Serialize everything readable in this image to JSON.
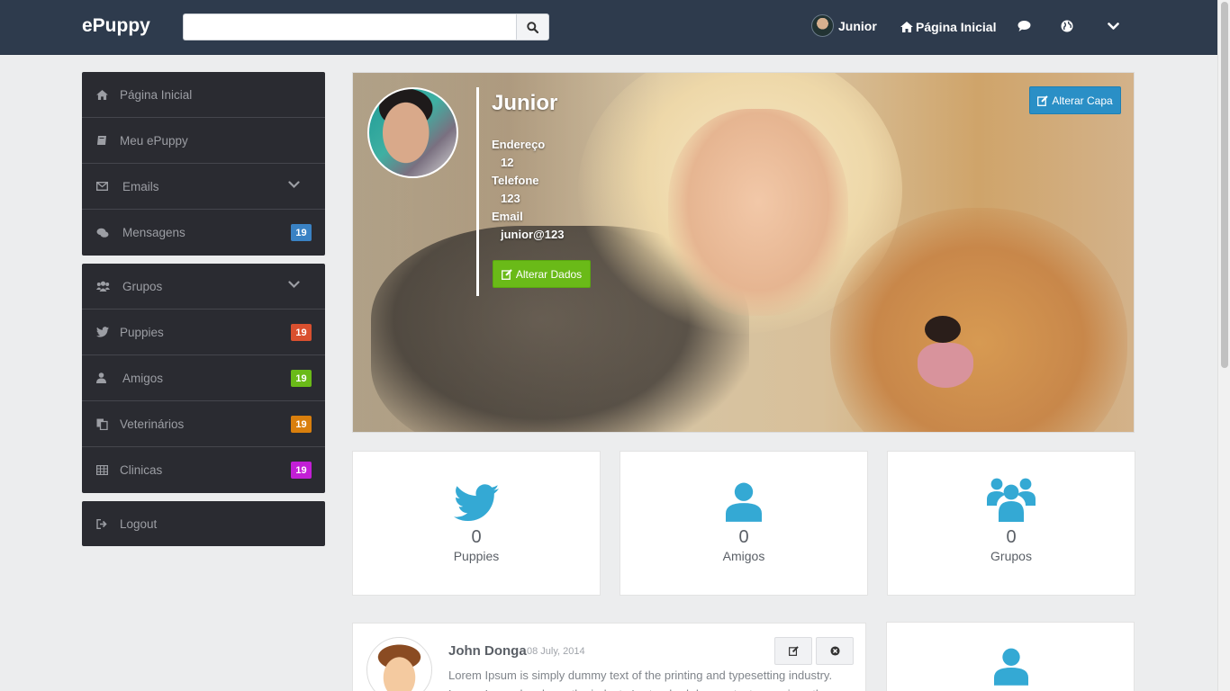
{
  "brand": "ePuppy",
  "search": {
    "value": "",
    "placeholder": ""
  },
  "nav": {
    "user": "Junior",
    "home": "Página Inicial",
    "icons": [
      "chat-icon",
      "globe-icon",
      "chevron-down-icon"
    ]
  },
  "sidebar": {
    "group1": [
      {
        "label": "Página Inicial",
        "icon": "home-icon"
      },
      {
        "label": "Meu ePuppy",
        "icon": "book-icon"
      },
      {
        "label": "Emails",
        "icon": "envelope-icon",
        "expandable": true
      },
      {
        "label": "Mensagens",
        "icon": "chat-icon",
        "badge": "19",
        "badge_color": "#3a82c4"
      }
    ],
    "group2": [
      {
        "label": "Grupos",
        "icon": "users-icon",
        "expandable": true
      },
      {
        "label": "Puppies",
        "icon": "twitter-icon",
        "badge": "19",
        "badge_color": "#d9502f"
      },
      {
        "label": "Amigos",
        "icon": "user-icon",
        "badge": "19",
        "badge_color": "#6aba18"
      },
      {
        "label": "Veterinários",
        "icon": "copy-icon",
        "badge": "19",
        "badge_color": "#d97f0d"
      },
      {
        "label": "Clinicas",
        "icon": "table-icon",
        "badge": "19",
        "badge_color": "#c21fd6"
      }
    ],
    "group3": [
      {
        "label": "Logout",
        "icon": "signout-icon"
      }
    ]
  },
  "profile": {
    "name": "Junior",
    "address_label": "Endereço",
    "address_value": "12",
    "phone_label": "Telefone",
    "phone_value": "123",
    "email_label": "Email",
    "email_value": "junior@123",
    "edit_data_button": "Alterar Dados",
    "edit_cover_button": "Alterar Capa"
  },
  "stats": [
    {
      "value": "0",
      "label": "Puppies",
      "icon": "twitter-icon"
    },
    {
      "value": "0",
      "label": "Amigos",
      "icon": "user-icon"
    },
    {
      "value": "0",
      "label": "Grupos",
      "icon": "users-icon"
    }
  ],
  "post": {
    "author": "John Donga",
    "date": "08 July, 2014",
    "text": "Lorem Ipsum is simply dummy text of the printing and typesetting industry. Lorem Ipsum has been the industry's standard dummy text ever since the"
  },
  "colors": {
    "topbar": "#2e3b4d",
    "sidebar": "#2a2b31",
    "accent": "#34a9d4",
    "green": "#6aba18",
    "blue": "#2a8fc6"
  }
}
